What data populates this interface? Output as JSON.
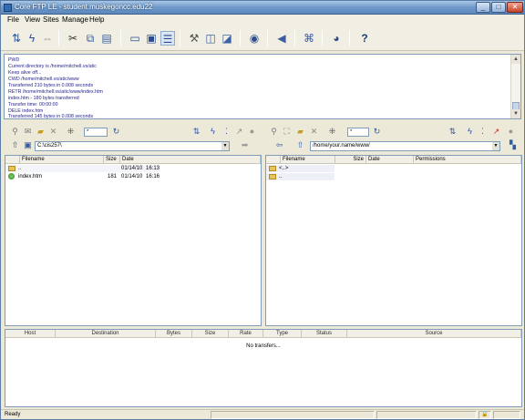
{
  "window": {
    "title": "Core FTP LE - student.muskegoncc.edu22"
  },
  "window_controls": {
    "minimize": "_",
    "maximize": "□",
    "close": "✕"
  },
  "menu": [
    "File",
    "View",
    "Sites",
    "Manage",
    "Help"
  ],
  "toolbar_icons": [
    "connect-icon",
    "quick-connect-icon",
    "disconnect-icon",
    "cut-icon",
    "copy-icon",
    "paste-icon",
    "view-icon",
    "edit-icon",
    "list-icon",
    "settings-icon",
    "site-manager-icon",
    "queue-icon",
    "view-eye-icon",
    "sound-icon",
    "tools-icon",
    "stop-icon",
    "help-icon"
  ],
  "log": {
    "lines": [
      "PWD",
      "Current directory is /home/mitchell.vs/atic",
      "Keep alive off...",
      "CWD /home/mitchell.vs/atic/www",
      "Transferred 210 bytes in 0.008 seconds",
      "RETR /home/mitchell.vs/atic/www/index.htm",
      "index.htm - 180 bytes transferred",
      "Transfer time: 00:00:00",
      "DELE index.htm",
      "Transferred 145 bytes in 0.008 seconds"
    ]
  },
  "local": {
    "filter_value": "*",
    "path": "C:\\cis257\\",
    "columns": [
      "Filename",
      "Size",
      "Date"
    ],
    "files": [
      {
        "name": "..",
        "size": "",
        "date": "01/14/10",
        "time": "16:13",
        "type": "folder"
      },
      {
        "name": "index.htm",
        "size": "181",
        "date": "01/14/10",
        "time": "16:16",
        "type": "file"
      }
    ]
  },
  "remote": {
    "filter_value": "*",
    "path": "/home/your.name/www/",
    "columns": [
      "Filename",
      "Size",
      "Date",
      "Permissions"
    ],
    "files": [
      {
        "name": "<..>",
        "type": "folder"
      },
      {
        "name": "..",
        "type": "folder"
      }
    ]
  },
  "transfers": {
    "columns": [
      "Host",
      "Destination",
      "Bytes",
      "Size",
      "Rate",
      "Type",
      "Status",
      "Source"
    ],
    "empty_text": "No transfers..."
  },
  "status": {
    "text": "Ready"
  },
  "colors": {
    "titlebar": "#6f99c8",
    "log_text": "#1e1e8c",
    "chrome": "#ece9d8"
  }
}
